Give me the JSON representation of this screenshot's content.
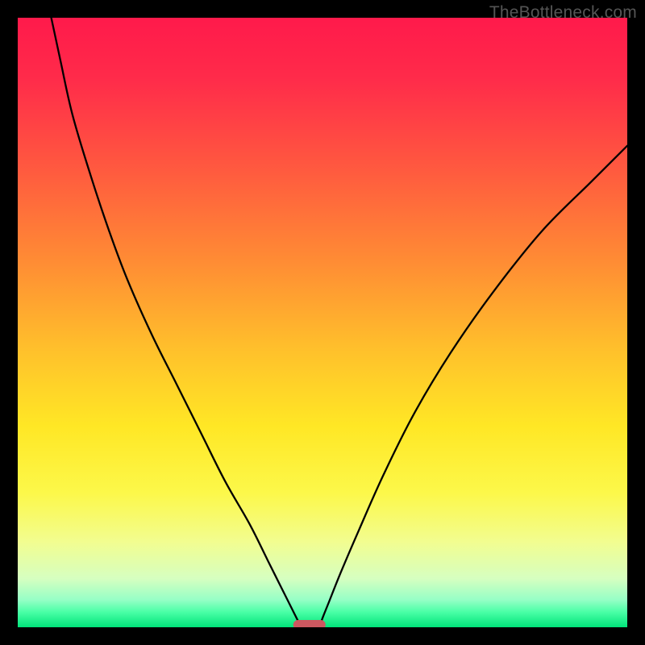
{
  "watermark": "TheBottleneck.com",
  "chart_data": {
    "type": "line",
    "title": "",
    "xlabel": "",
    "ylabel": "",
    "xlim": [
      0,
      100
    ],
    "ylim": [
      0,
      100
    ],
    "background_gradient_stops": [
      {
        "offset": 0.0,
        "color": "#ff1a4b"
      },
      {
        "offset": 0.1,
        "color": "#ff2b4a"
      },
      {
        "offset": 0.25,
        "color": "#ff5a3f"
      },
      {
        "offset": 0.4,
        "color": "#ff8c34"
      },
      {
        "offset": 0.55,
        "color": "#ffc22b"
      },
      {
        "offset": 0.67,
        "color": "#ffe725"
      },
      {
        "offset": 0.78,
        "color": "#fcf84a"
      },
      {
        "offset": 0.86,
        "color": "#f2fd90"
      },
      {
        "offset": 0.92,
        "color": "#d6ffc0"
      },
      {
        "offset": 0.955,
        "color": "#96ffc6"
      },
      {
        "offset": 0.975,
        "color": "#4affa6"
      },
      {
        "offset": 1.0,
        "color": "#00e47a"
      }
    ],
    "series": [
      {
        "name": "left-branch",
        "x": [
          5.5,
          7,
          9,
          12,
          15,
          18,
          22,
          26,
          30,
          34,
          38,
          41,
          43,
          44.5,
          45.5,
          46,
          46.5
        ],
        "values": [
          100,
          93,
          84,
          74,
          65,
          57,
          48,
          40,
          32,
          24,
          17,
          11,
          7,
          4,
          2,
          1,
          0
        ]
      },
      {
        "name": "right-branch",
        "x": [
          49.5,
          50,
          51,
          53,
          56,
          60,
          65,
          71,
          78,
          86,
          94,
          100
        ],
        "values": [
          0,
          1.5,
          4,
          9,
          16,
          25,
          35,
          45,
          55,
          65,
          73,
          79
        ]
      }
    ],
    "marker": {
      "name": "bottleneck-marker",
      "x_range": [
        45.2,
        50.5
      ],
      "y": 0.4,
      "color": "#cc5860",
      "thickness_px": 12
    }
  }
}
